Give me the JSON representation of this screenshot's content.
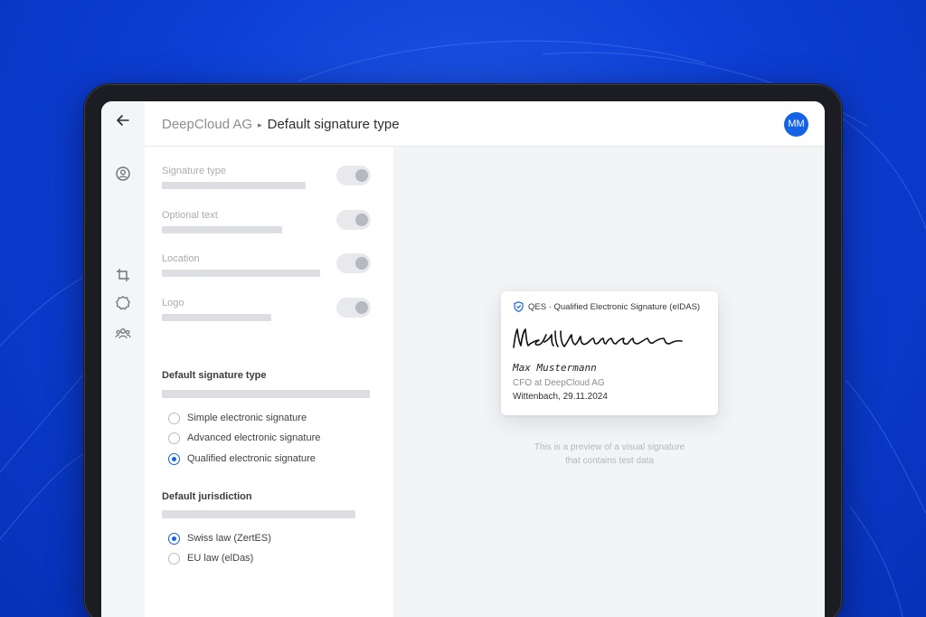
{
  "header": {
    "organization": "DeepCloud AG",
    "separator": "▸",
    "title": "Default signature type",
    "avatar_initials": "MM"
  },
  "rail": {
    "icons": [
      "back-arrow-icon",
      "user-circle-icon",
      "crop-icon",
      "settings-badge-icon",
      "team-icon"
    ]
  },
  "settings": {
    "toggles": [
      {
        "label": "Signature type",
        "enabled": true
      },
      {
        "label": "Optional text",
        "enabled": true
      },
      {
        "label": "Location",
        "enabled": true
      },
      {
        "label": "Logo",
        "enabled": true
      }
    ],
    "signature_type": {
      "title": "Default signature type",
      "options": [
        "Simple electronic signature",
        "Advanced electronic signature",
        "Qualified electronic signature"
      ],
      "selected": "Qualified electronic signature"
    },
    "jurisdiction": {
      "title": "Default jurisdiction",
      "options": [
        "Swiss law (ZertES)",
        "EU law (elDas)"
      ],
      "selected": "Swiss law (ZertES)"
    }
  },
  "preview": {
    "card": {
      "badge_text": "QES · Qualified Electronic Signature (eIDAS)",
      "signer_name": "Max Mustermann",
      "signer_role": "CFO at DeepCloud AG",
      "place_date": "Wittenbach, 29.11.2024"
    },
    "note_line1": "This is a preview of a visual signature",
    "note_line2": "that contains test data"
  },
  "colors": {
    "accent": "#1463e6",
    "background": "#0d3fd6",
    "device": "#1b1d22"
  }
}
